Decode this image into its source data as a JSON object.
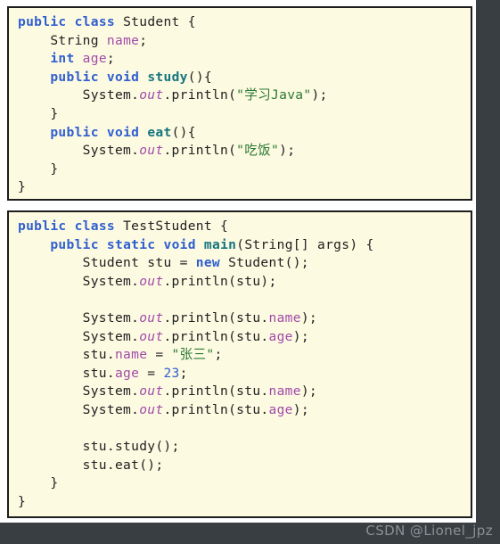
{
  "page": {
    "background_color": "#383e42",
    "sheet_color": "#ffffff",
    "watermark": "CSDN @Lionel_jpz"
  },
  "theme": {
    "code_background": "#fdfae2",
    "code_border": "#1d1d1d",
    "keyword_color": "#2f5fcf",
    "field_color": "#a14ba8",
    "method_color": "#16767f",
    "string_color": "#2a7a32",
    "number_color": "#2f5fcf",
    "plain_color": "#202020"
  },
  "code_blocks": [
    {
      "name": "student-class",
      "language": "java",
      "lines": [
        "public class Student {",
        "    String name;",
        "    int age;",
        "    public void study(){",
        "        System.out.println(\"学习Java\");",
        "    }",
        "    public void eat(){",
        "        System.out.println(\"吃饭\");",
        "    }",
        "}"
      ]
    },
    {
      "name": "test-student-class",
      "language": "java",
      "lines": [
        "public class TestStudent {",
        "    public static void main(String[] args) {",
        "        Student stu = new Student();",
        "        System.out.println(stu);",
        "",
        "        System.out.println(stu.name);",
        "        System.out.println(stu.age);",
        "        stu.name = \"张三\";",
        "        stu.age = 23;",
        "        System.out.println(stu.name);",
        "        System.out.println(stu.age);",
        "",
        "        stu.study();",
        "        stu.eat();",
        "    }",
        "}"
      ]
    }
  ]
}
